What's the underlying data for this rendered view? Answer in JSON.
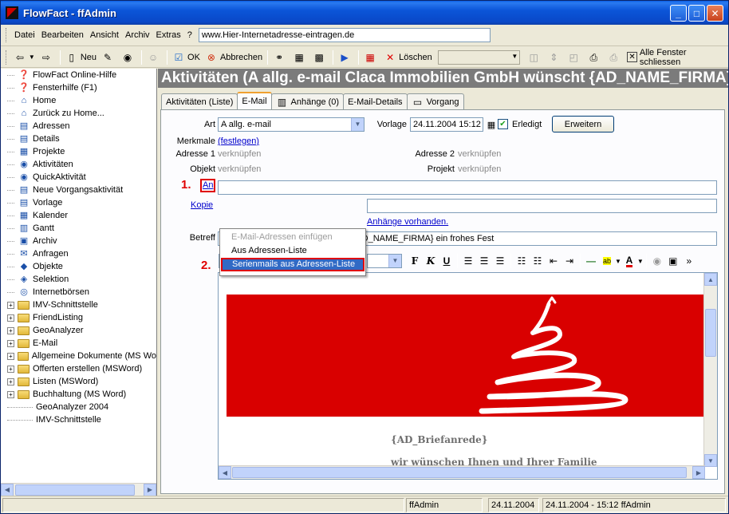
{
  "window": {
    "title": "FlowFact - ffAdmin",
    "minimize": "_",
    "maximize": "□",
    "close": "✕"
  },
  "menu": {
    "items": [
      "Datei",
      "Bearbeiten",
      "Ansicht",
      "Archiv",
      "Extras",
      "?"
    ],
    "address_value": "www.Hier-Internetadresse-eintragen.de"
  },
  "toolbar": {
    "new_label": "Neu",
    "ok_label": "OK",
    "cancel_label": "Abbrechen",
    "delete_label": "Löschen",
    "close_all_label": "Alle Fenster schliessen"
  },
  "tree": {
    "items": [
      {
        "label": "FlowFact Online-Hilfe",
        "icon": "help-icon",
        "glyph": "❓"
      },
      {
        "label": "Fensterhilfe (F1)",
        "icon": "help-icon",
        "glyph": "❓"
      },
      {
        "label": "Home",
        "icon": "home-icon",
        "glyph": "⌂"
      },
      {
        "label": "Zurück zu Home...",
        "icon": "home-icon",
        "glyph": "⌂"
      },
      {
        "label": "Adressen",
        "icon": "address-card-icon",
        "glyph": "▤"
      },
      {
        "label": "Details",
        "icon": "document-icon",
        "glyph": "▤"
      },
      {
        "label": "Projekte",
        "icon": "project-icon",
        "glyph": "▦"
      },
      {
        "label": "Aktivitäten",
        "icon": "globe-icon",
        "glyph": "◉"
      },
      {
        "label": "QuickAktivität",
        "icon": "globe-icon",
        "glyph": "◉"
      },
      {
        "label": "Neue Vorgangsaktivität",
        "icon": "document-icon",
        "glyph": "▤"
      },
      {
        "label": "Vorlage",
        "icon": "template-icon",
        "glyph": "▤"
      },
      {
        "label": "Kalender",
        "icon": "calendar-icon",
        "glyph": "▦"
      },
      {
        "label": "Gantt",
        "icon": "gantt-icon",
        "glyph": "▥"
      },
      {
        "label": "Archiv",
        "icon": "archive-icon",
        "glyph": "▣"
      },
      {
        "label": "Anfragen",
        "icon": "inquiry-icon",
        "glyph": "✉"
      },
      {
        "label": "Objekte",
        "icon": "object-icon",
        "glyph": "◆"
      },
      {
        "label": "Selektion",
        "icon": "selection-icon",
        "glyph": "◈"
      },
      {
        "label": "Internetbörsen",
        "icon": "internet-icon",
        "glyph": "◎"
      }
    ],
    "folders": [
      "IMV-Schnittstelle",
      "FriendListing",
      "GeoAnalyzer",
      "E-Mail",
      "Allgemeine Dokumente (MS Wo",
      "Offerten erstellen (MSWord)",
      "Listen (MSWord)",
      "Buchhaltung (MS Word)"
    ],
    "plain": [
      "GeoAnalyzer 2004",
      "IMV-Schnittstelle"
    ]
  },
  "content": {
    "header": "Aktivitäten (A allg. e-mail Claca Immobilien GmbH wünscht {AD_NAME_FIRMA}) -",
    "tabs": [
      "Aktivitäten (Liste)",
      "E-Mail",
      "Anhänge (0)",
      "E-Mail-Details",
      "Vorgang"
    ]
  },
  "form": {
    "art_label": "Art",
    "art_value": "A allg. e-mail",
    "vorlage_label": "Vorlage",
    "vorlage_value": "24.11.2004 15:12",
    "erledigt_label": "Erledigt",
    "erweitern_label": "Erweitern",
    "merkmale_label": "Merkmale",
    "merkmale_link": "(festlegen)",
    "adresse1_label": "Adresse 1",
    "adresse1_value": "verknüpfen",
    "adresse2_label": "Adresse 2",
    "adresse2_value": "verknüpfen",
    "objekt_label": "Objekt",
    "objekt_value": "verknüpfen",
    "projekt_label": "Projekt",
    "projekt_value": "verknüpfen",
    "an_link": "An",
    "kopie_link": "Kopie",
    "attachments_link": "Anhänge vorhanden.",
    "betreff_label": "Betreff",
    "betreff_value": "Claca Immobilien GmbH wünscht {AD_NAME_FIRMA} ein frohes Fest",
    "marker1": "1.",
    "marker2": "2."
  },
  "popup": {
    "items": [
      "E-Mail-Adressen einfügen",
      "Aus Adressen-Liste",
      "Serienmails aus Adressen-Liste"
    ]
  },
  "editor": {
    "font": "MS Sans Serif",
    "greeting": "{AD_Briefanrede}",
    "line1": "wir wünschen Ihnen und Ihrer Familie",
    "bold_glyph": "F",
    "italic_glyph": "K",
    "underline_glyph": "U"
  },
  "status": {
    "user": "ffAdmin",
    "date": "24.11.2004",
    "modified": "24.11.2004 - 15:12 ffAdmin"
  },
  "colors": {
    "banner_red": "#d90000",
    "titlebar_blue": "#0a48c8",
    "header_gray": "#7b7b7b"
  }
}
